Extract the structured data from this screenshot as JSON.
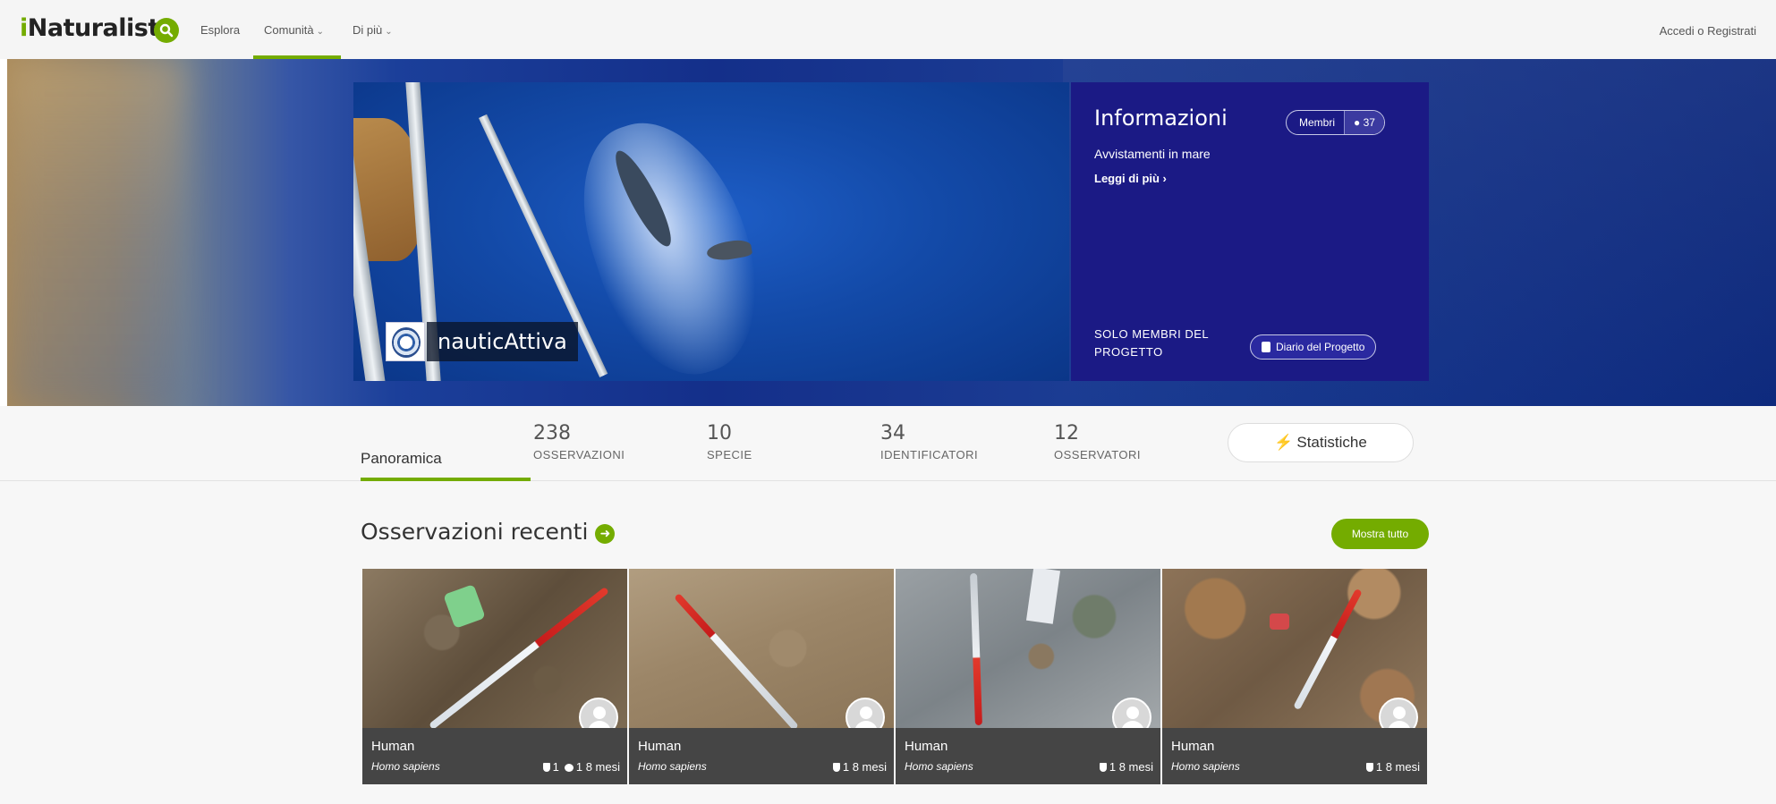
{
  "nav": {
    "logo_i": "i",
    "logo_rest": "Naturalist",
    "items": [
      "Esplora",
      "Comunità",
      "Di più"
    ],
    "login": "Accedi o Registrati"
  },
  "project": {
    "title": "nauticAttiva",
    "info_title": "Informazioni",
    "members_label": "Membri",
    "members_count": "37",
    "description": "Avvistamenti in mare",
    "read_more": "Leggi di più ›",
    "members_only": "SOLO MEMBRI DEL PROGETTO",
    "journal_label": "Diario del Progetto"
  },
  "tabs": {
    "overview": "Panoramica",
    "stats": [
      {
        "num": "238",
        "label": "OSSERVAZIONI"
      },
      {
        "num": "10",
        "label": "SPECIE"
      },
      {
        "num": "34",
        "label": "IDENTIFICATORI"
      },
      {
        "num": "12",
        "label": "OSSERVATORI"
      }
    ],
    "stats_button": "Statistiche"
  },
  "recent": {
    "title": "Osservazioni recenti",
    "show_all": "Mostra tutto",
    "items": [
      {
        "common": "Human",
        "sci": "Homo sapiens",
        "ids": "1",
        "comments": "1",
        "age": "8 mesi"
      },
      {
        "common": "Human",
        "sci": "Homo sapiens",
        "ids": "1",
        "age": "8 mesi"
      },
      {
        "common": "Human",
        "sci": "Homo sapiens",
        "ids": "1",
        "age": "8 mesi"
      },
      {
        "common": "Human",
        "sci": "Homo sapiens",
        "ids": "1",
        "age": "8 mesi"
      }
    ]
  },
  "colors": {
    "brand": "#74ac00",
    "info_panel": "#1b1a85",
    "caption_bg": "#454545"
  }
}
